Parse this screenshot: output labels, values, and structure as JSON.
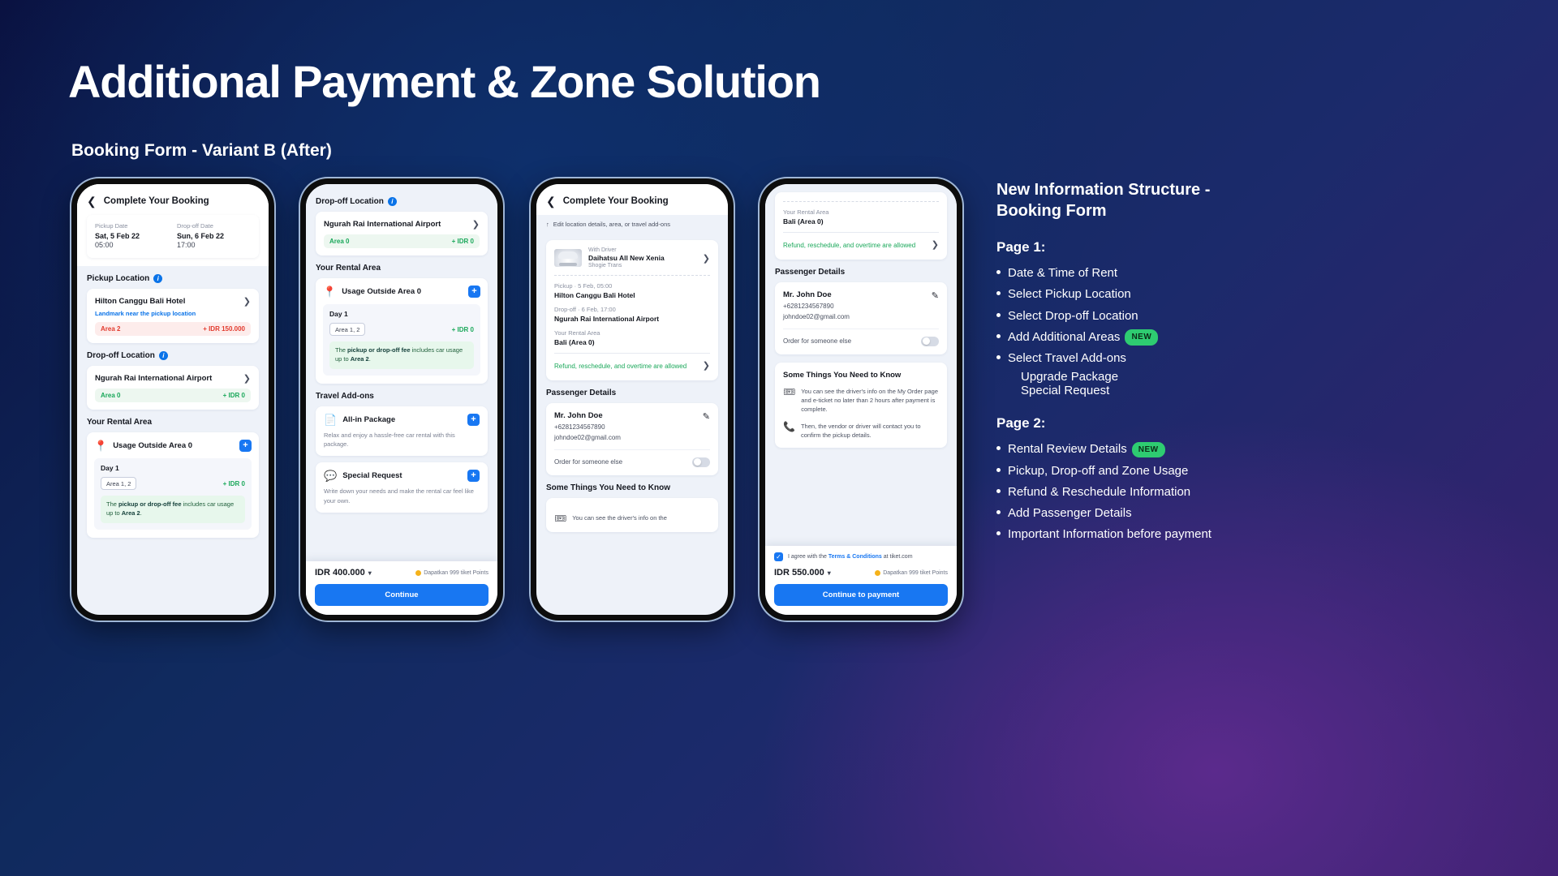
{
  "header": {
    "title": "Additional Payment & Zone Solution",
    "subtitle": "Booking Form - Variant B (After)"
  },
  "common": {
    "app_title": "Complete Your Booking",
    "back_icon": "chevron-left-icon",
    "info_icon": "info-icon",
    "chevron_right": "chevron-right-icon"
  },
  "phone1": {
    "app_title": "Complete Your Booking",
    "dates": {
      "pickup_label": "Pickup Date",
      "pickup_value": "Sat, 5 Feb 22",
      "pickup_time": "05:00",
      "dropoff_label": "Drop-off Date",
      "dropoff_value": "Sun, 6 Feb 22",
      "dropoff_time": "17:00"
    },
    "pickup": {
      "section": "Pickup Location",
      "name": "Hilton Canggu Bali Hotel",
      "landmark": "Landmark near the pickup location",
      "area": "Area 2",
      "fee": "+ IDR 150.000"
    },
    "dropoff": {
      "section": "Drop-off Location",
      "name": "Ngurah Rai International Airport",
      "area": "Area 0",
      "fee": "+ IDR 0"
    },
    "rental": {
      "section": "Your Rental Area",
      "title": "Usage Outside Area 0",
      "day": "Day 1",
      "tag": "Area 1, 2",
      "fee": "+ IDR 0",
      "notice_pre": "The ",
      "notice_b1": "pickup or drop-off fee",
      "notice_mid": " includes car usage up to ",
      "notice_b2": "Area 2",
      "notice_end": "."
    }
  },
  "phone2": {
    "dropoff": {
      "section": "Drop-off Location",
      "name": "Ngurah Rai International Airport",
      "area": "Area 0",
      "fee": "+ IDR 0"
    },
    "rental": {
      "section": "Your Rental Area",
      "title": "Usage Outside Area 0",
      "day": "Day 1",
      "tag": "Area 1, 2",
      "fee": "+ IDR 0",
      "notice_pre": "The ",
      "notice_b1": "pickup or drop-off fee",
      "notice_mid": " includes car usage up to ",
      "notice_b2": "Area 2",
      "notice_end": "."
    },
    "addons": {
      "section": "Travel Add-ons",
      "items": [
        {
          "icon": "id-card-icon",
          "title": "All-in Package",
          "desc": "Relax and enjoy a hassle-free car rental with this package."
        },
        {
          "icon": "speech-bubble-icon",
          "title": "Special Request",
          "desc": "Write down your needs and make the rental car feel like your own."
        }
      ]
    },
    "bottom": {
      "price": "IDR 400.000",
      "caret": "chevron-down-icon",
      "points": "Dapatkan 999 tiket Points",
      "cta": "Continue"
    }
  },
  "phone3": {
    "app_title": "Complete Your Booking",
    "edit_hint": "Edit location details, area, or travel add-ons",
    "edit_icon": "arrow-up-icon",
    "car": {
      "driver_label": "With Driver",
      "model": "Daihatsu All New Xenia",
      "vendor": "Shogie Trans"
    },
    "trip": {
      "pickup_label": "Pickup · 5 Feb, 05:00",
      "pickup_value": "Hilton Canggu Bali Hotel",
      "dropoff_label": "Drop-off · 6 Feb, 17:00",
      "dropoff_value": "Ngurah Rai International Airport",
      "area_label": "Your Rental Area",
      "area_value": "Bali (Area 0)",
      "refund": "Refund, reschedule, and overtime are allowed"
    },
    "passenger": {
      "section": "Passenger Details",
      "name": "Mr. John Doe",
      "phone": "+6281234567890",
      "email": "johndoe02@gmail.com",
      "edit_icon": "pencil-icon",
      "toggle_label": "Order for someone else"
    },
    "things": {
      "section": "Some Things You Need to Know",
      "first": "You can see the driver's info on the"
    }
  },
  "phone4": {
    "area_label": "Your Rental Area",
    "area_value": "Bali (Area 0)",
    "refund": "Refund, reschedule, and overtime are allowed",
    "passenger": {
      "section": "Passenger Details",
      "name": "Mr. John Doe",
      "phone": "+6281234567890",
      "email": "johndoe02@gmail.com",
      "edit_icon": "pencil-icon",
      "toggle_label": "Order for someone else"
    },
    "things": {
      "section": "Some Things You Need to Know",
      "items": [
        {
          "icon": "ticket-icon",
          "text": "You can see the driver's info on the My Order page and e-ticket no later than 2 hours after payment is complete."
        },
        {
          "icon": "phone-icon",
          "text": "Then, the vendor or driver will contact you to confirm the pickup details."
        }
      ]
    },
    "tnc": {
      "pre": "I agree with the ",
      "link": "Terms & Conditions",
      "post": " at tiket.com"
    },
    "bottom": {
      "price": "IDR 550.000",
      "caret": "chevron-down-icon",
      "points": "Dapatkan 999 tiket Points",
      "cta": "Continue to payment"
    }
  },
  "rightpanel": {
    "title": "New Information Structure - Booking Form",
    "page1_heading": "Page 1:",
    "page1_items": [
      {
        "text": "Date & Time of Rent",
        "badge": ""
      },
      {
        "text": "Select Pickup Location",
        "badge": ""
      },
      {
        "text": "Select Drop-off Location",
        "badge": ""
      },
      {
        "text": "Add Additional Areas",
        "badge": "NEW"
      },
      {
        "text": "Select Travel Add-ons",
        "badge": ""
      }
    ],
    "page1_sub": [
      "Upgrade Package",
      "Special Request"
    ],
    "page2_heading": "Page 2:",
    "page2_items": [
      {
        "text": "Rental Review Details",
        "badge": "NEW"
      },
      {
        "text": "Pickup, Drop-off and Zone Usage",
        "badge": ""
      },
      {
        "text": "Refund & Reschedule Information",
        "badge": ""
      },
      {
        "text": "Add Passenger Details",
        "badge": ""
      },
      {
        "text": "Important Information before payment",
        "badge": ""
      }
    ]
  }
}
